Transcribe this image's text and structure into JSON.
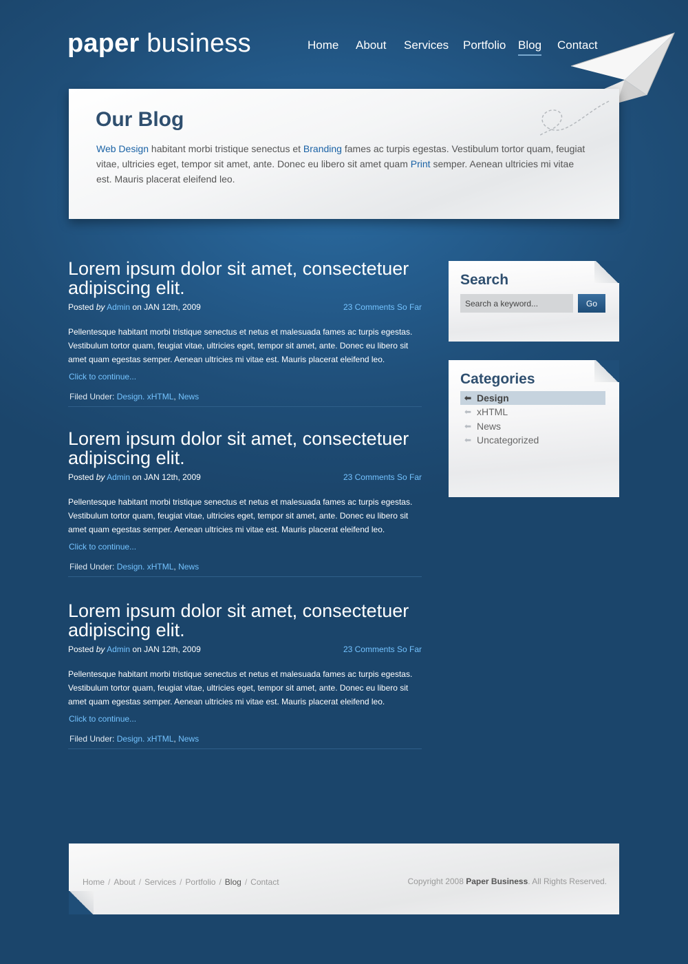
{
  "header": {
    "logo_bold": "paper",
    "logo_light": "business",
    "nav": [
      {
        "label": "Home",
        "active": false
      },
      {
        "label": "About",
        "active": false
      },
      {
        "label": "Services",
        "active": false
      },
      {
        "label": "Portfolio",
        "active": false
      },
      {
        "label": "Blog",
        "active": true
      },
      {
        "label": "Contact",
        "active": false
      }
    ]
  },
  "hero": {
    "title": "Our Blog",
    "link1": "Web Design",
    "text1": " habitant morbi tristique senectus et ",
    "link2": "Branding",
    "text2": " fames ac turpis egestas. Vestibulum tortor quam, feugiat vitae, ultricies eget, tempor sit amet, ante. Donec eu libero sit amet quam ",
    "link3": "Print",
    "text3": " semper. Aenean ultricies mi vitae est. Mauris placerat eleifend leo."
  },
  "posts": [
    {
      "title": "Lorem ipsum dolor sit amet, consectetuer adipiscing elit.",
      "posted": "Posted ",
      "by": "by",
      "author": "Admin",
      "date": " on JAN 12th, 2009",
      "comments": "23 Comments So Far",
      "excerpt": "Pellentesque habitant morbi tristique senectus et netus et malesuada fames ac turpis egestas. Vestibulum tortor quam, feugiat vitae, ultricies eget, tempor sit amet, ante. Donec eu libero sit amet quam egestas semper. Aenean ultricies mi vitae est. Mauris placerat eleifend leo.",
      "more": "Click to continue...",
      "filed_label": "Filed Under: ",
      "cat1": "Design. xHTML",
      "cat_sep": ", ",
      "cat2": "News"
    },
    {
      "title": "Lorem ipsum dolor sit amet, consectetuer adipiscing elit.",
      "posted": "Posted ",
      "by": "by",
      "author": "Admin",
      "date": " on JAN 12th, 2009",
      "comments": "23 Comments So Far",
      "excerpt": "Pellentesque habitant morbi tristique senectus et netus et malesuada fames ac turpis egestas. Vestibulum tortor quam, feugiat vitae, ultricies eget, tempor sit amet, ante. Donec eu libero sit amet quam egestas semper. Aenean ultricies mi vitae est. Mauris placerat eleifend leo.",
      "more": "Click to continue...",
      "filed_label": "Filed Under: ",
      "cat1": "Design. xHTML",
      "cat_sep": ", ",
      "cat2": "News"
    },
    {
      "title": "Lorem ipsum dolor sit amet, consectetuer adipiscing elit.",
      "posted": "Posted ",
      "by": "by",
      "author": "Admin",
      "date": " on JAN 12th, 2009",
      "comments": "23 Comments So Far",
      "excerpt": "Pellentesque habitant morbi tristique senectus et netus et malesuada fames ac turpis egestas. Vestibulum tortor quam, feugiat vitae, ultricies eget, tempor sit amet, ante. Donec eu libero sit amet quam egestas semper. Aenean ultricies mi vitae est. Mauris placerat eleifend leo.",
      "more": "Click to continue...",
      "filed_label": "Filed Under: ",
      "cat1": "Design. xHTML",
      "cat_sep": ", ",
      "cat2": "News"
    }
  ],
  "search": {
    "title": "Search",
    "placeholder": "Search a keyword...",
    "button": "Go"
  },
  "categories": {
    "title": "Categories",
    "items": [
      {
        "label": "Design",
        "active": true
      },
      {
        "label": "xHTML",
        "active": false
      },
      {
        "label": "News",
        "active": false
      },
      {
        "label": "Uncategorized",
        "active": false
      }
    ]
  },
  "footer": {
    "nav": [
      "Home",
      "About",
      "Services",
      "Portfolio",
      "Blog",
      "Contact"
    ],
    "current": "Blog",
    "separator": "/",
    "copyright_prefix": "Copyright 2008 ",
    "copyright_brand": "Paper Business",
    "copyright_suffix": ". All Rights Reserved."
  },
  "colors": {
    "background": "#1f4e78",
    "link_light": "#74c3ff",
    "link_dark": "#1a62a5",
    "heading": "#2f4f6f"
  }
}
